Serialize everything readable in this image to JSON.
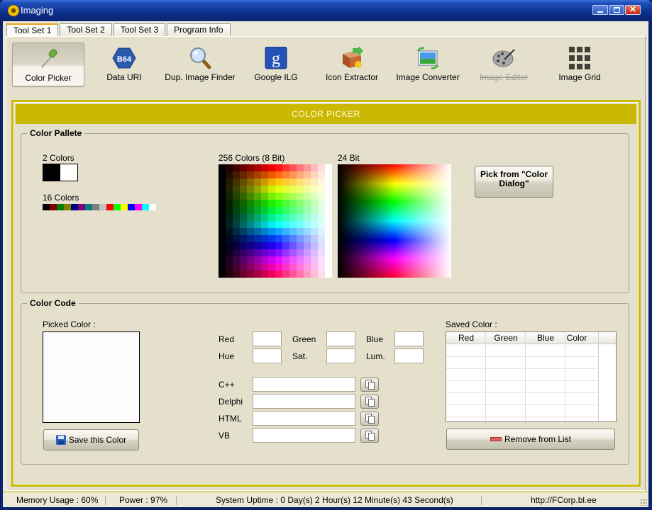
{
  "window": {
    "title": "Imaging",
    "controls": {
      "minimize": "minimize",
      "maximize": "maximize",
      "close": "✕"
    }
  },
  "tabs": [
    {
      "label": "Tool Set 1",
      "active": true
    },
    {
      "label": "Tool Set 2",
      "active": false
    },
    {
      "label": "Tool Set 3",
      "active": false
    },
    {
      "label": "Program Info",
      "active": false
    }
  ],
  "toolbar": [
    {
      "label": "Color Picker",
      "icon": "eyedropper-icon",
      "active": true,
      "disabled": false
    },
    {
      "label": "Data URI",
      "icon": "b64-icon",
      "active": false,
      "disabled": false,
      "badge": "B64"
    },
    {
      "label": "Dup. Image Finder",
      "icon": "magnifier-icon",
      "active": false,
      "disabled": false
    },
    {
      "label": "Google ILG",
      "icon": "google-icon",
      "active": false,
      "disabled": false,
      "badge": "g"
    },
    {
      "label": "Icon Extractor",
      "icon": "box-extract-icon",
      "active": false,
      "disabled": false
    },
    {
      "label": "Image Converter",
      "icon": "image-convert-icon",
      "active": false,
      "disabled": false
    },
    {
      "label": "Image Editor",
      "icon": "palette-icon",
      "active": false,
      "disabled": true
    },
    {
      "label": "Image Grid",
      "icon": "grid-icon",
      "active": false,
      "disabled": false
    }
  ],
  "banner": {
    "title": "COLOR PICKER",
    "color": "#cbb800"
  },
  "palette": {
    "group_title": "Color Pallete",
    "two_colors_label": "2 Colors",
    "two_colors": [
      "#000000",
      "#ffffff"
    ],
    "sixteen_colors_label": "16 Colors",
    "sixteen_colors": [
      "#000000",
      "#800000",
      "#008000",
      "#808000",
      "#000080",
      "#800080",
      "#008080",
      "#808080",
      "#c0c0c0",
      "#ff0000",
      "#00ff00",
      "#ffff00",
      "#0000ff",
      "#ff00ff",
      "#00ffff",
      "#ffffff"
    ],
    "colors256_label": "256 Colors (8 Bit)",
    "bit24_label": "24 Bit",
    "pick_dialog_button": "Pick from \"Color Dialog\""
  },
  "color_code": {
    "group_title": "Color Code",
    "picked_label": "Picked Color :",
    "picked_color": "#fcfcfc",
    "save_button": "Save this Color",
    "fields": {
      "red": {
        "label": "Red",
        "value": ""
      },
      "green": {
        "label": "Green",
        "value": ""
      },
      "blue": {
        "label": "Blue",
        "value": ""
      },
      "hue": {
        "label": "Hue",
        "value": ""
      },
      "sat": {
        "label": "Sat.",
        "value": ""
      },
      "lum": {
        "label": "Lum.",
        "value": ""
      }
    },
    "codes": [
      {
        "label": "C++",
        "value": ""
      },
      {
        "label": "Delphi",
        "value": ""
      },
      {
        "label": "HTML",
        "value": ""
      },
      {
        "label": "VB",
        "value": ""
      }
    ],
    "saved_label": "Saved Color :",
    "saved_columns": [
      "Red",
      "Green",
      "Blue",
      "Color"
    ],
    "saved_rows": [],
    "remove_button": "Remove from List"
  },
  "status": {
    "memory": "Memory Usage : 60%",
    "power": "Power : 97%",
    "uptime": "System Uptime : 0 Day(s) 2 Hour(s) 12 Minute(s) 43 Second(s)",
    "url": "http://FCorp.bl.ee"
  }
}
